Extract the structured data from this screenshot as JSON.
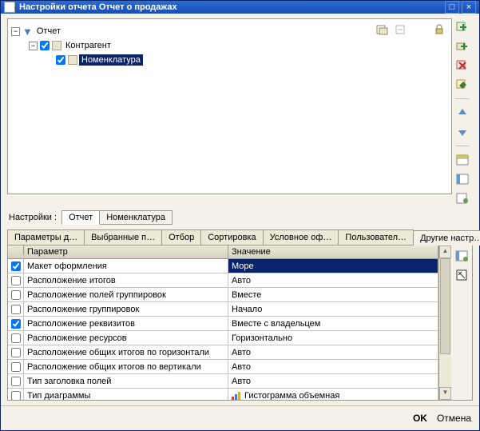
{
  "window": {
    "title": "Настройки отчета  Отчет о продажах"
  },
  "tree": {
    "root": {
      "label": "Отчет",
      "expanded": true
    },
    "child1": {
      "label": "Контрагент",
      "checked": true,
      "expanded": true
    },
    "child2": {
      "label": "Номенклатура",
      "checked": true,
      "selected": true
    }
  },
  "settings_label": "Настройки :",
  "selector_tabs": [
    "Отчет",
    "Номенклатура"
  ],
  "selector_active": 0,
  "main_tabs": [
    "Параметры д…",
    "Выбранные п…",
    "Отбор",
    "Сортировка",
    "Условное оф…",
    "Пользовател…",
    "Другие настр…"
  ],
  "main_active": 6,
  "grid": {
    "headers": {
      "param": "Параметр",
      "value": "Значение"
    },
    "rows": [
      {
        "checked": true,
        "param": "Макет оформления",
        "value": "Море",
        "selected": true
      },
      {
        "checked": false,
        "param": "Расположение итогов",
        "value": "Авто"
      },
      {
        "checked": false,
        "param": "Расположение полей группировок",
        "value": "Вместе"
      },
      {
        "checked": false,
        "param": "Расположение группировок",
        "value": "Начало"
      },
      {
        "checked": true,
        "param": "Расположение реквизитов",
        "value": "Вместе с владельцем"
      },
      {
        "checked": false,
        "param": "Расположение ресурсов",
        "value": "Горизонтально"
      },
      {
        "checked": false,
        "param": "Расположение общих итогов по горизонтали",
        "value": "Авто"
      },
      {
        "checked": false,
        "param": "Расположение общих итогов по вертикали",
        "value": "Авто"
      },
      {
        "checked": false,
        "param": "Тип заголовка полей",
        "value": "Авто"
      },
      {
        "checked": false,
        "param": "Тип диаграммы",
        "value": "Гистограмма объемная",
        "icon": "chart"
      }
    ]
  },
  "footer": {
    "ok": "OK",
    "cancel": "Отмена"
  }
}
